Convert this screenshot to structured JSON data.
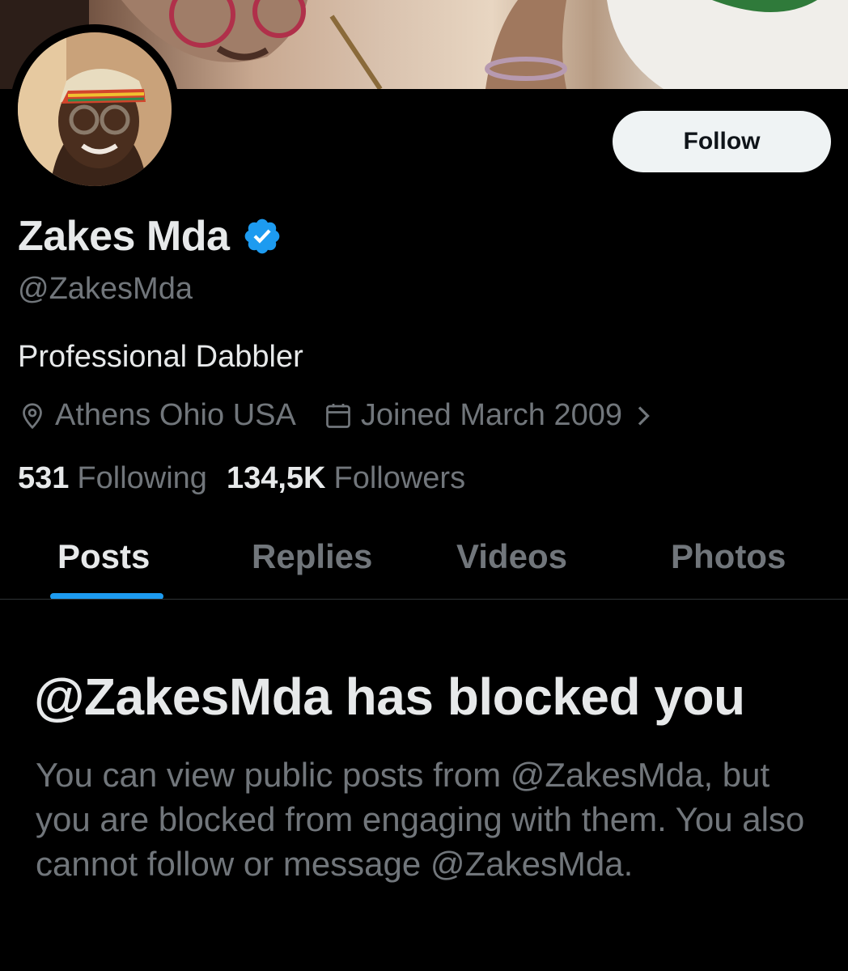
{
  "profile": {
    "display_name": "Zakes Mda",
    "handle": "@ZakesMda",
    "bio": "Professional Dabbler",
    "location": "Athens Ohio USA",
    "joined": "Joined March 2009",
    "following_count": "531",
    "following_label": "Following",
    "followers_count": "134,5K",
    "followers_label": "Followers"
  },
  "actions": {
    "follow_label": "Follow"
  },
  "tabs": [
    {
      "label": "Posts",
      "active": true
    },
    {
      "label": "Replies",
      "active": false
    },
    {
      "label": "Videos",
      "active": false
    },
    {
      "label": "Photos",
      "active": false
    }
  ],
  "blocked": {
    "title": "@ZakesMda has blocked you",
    "body": "You can view public posts from @ZakesMda, but you are blocked from engaging with them. You also cannot follow or message @ZakesMda."
  },
  "colors": {
    "accent": "#1d9bf0",
    "background": "#000000",
    "text_primary": "#e7e9ea",
    "text_secondary": "#71767b"
  },
  "icons": {
    "verified": "verified-badge-icon",
    "location": "location-pin-icon",
    "calendar": "calendar-icon",
    "chevron": "chevron-right-icon"
  }
}
